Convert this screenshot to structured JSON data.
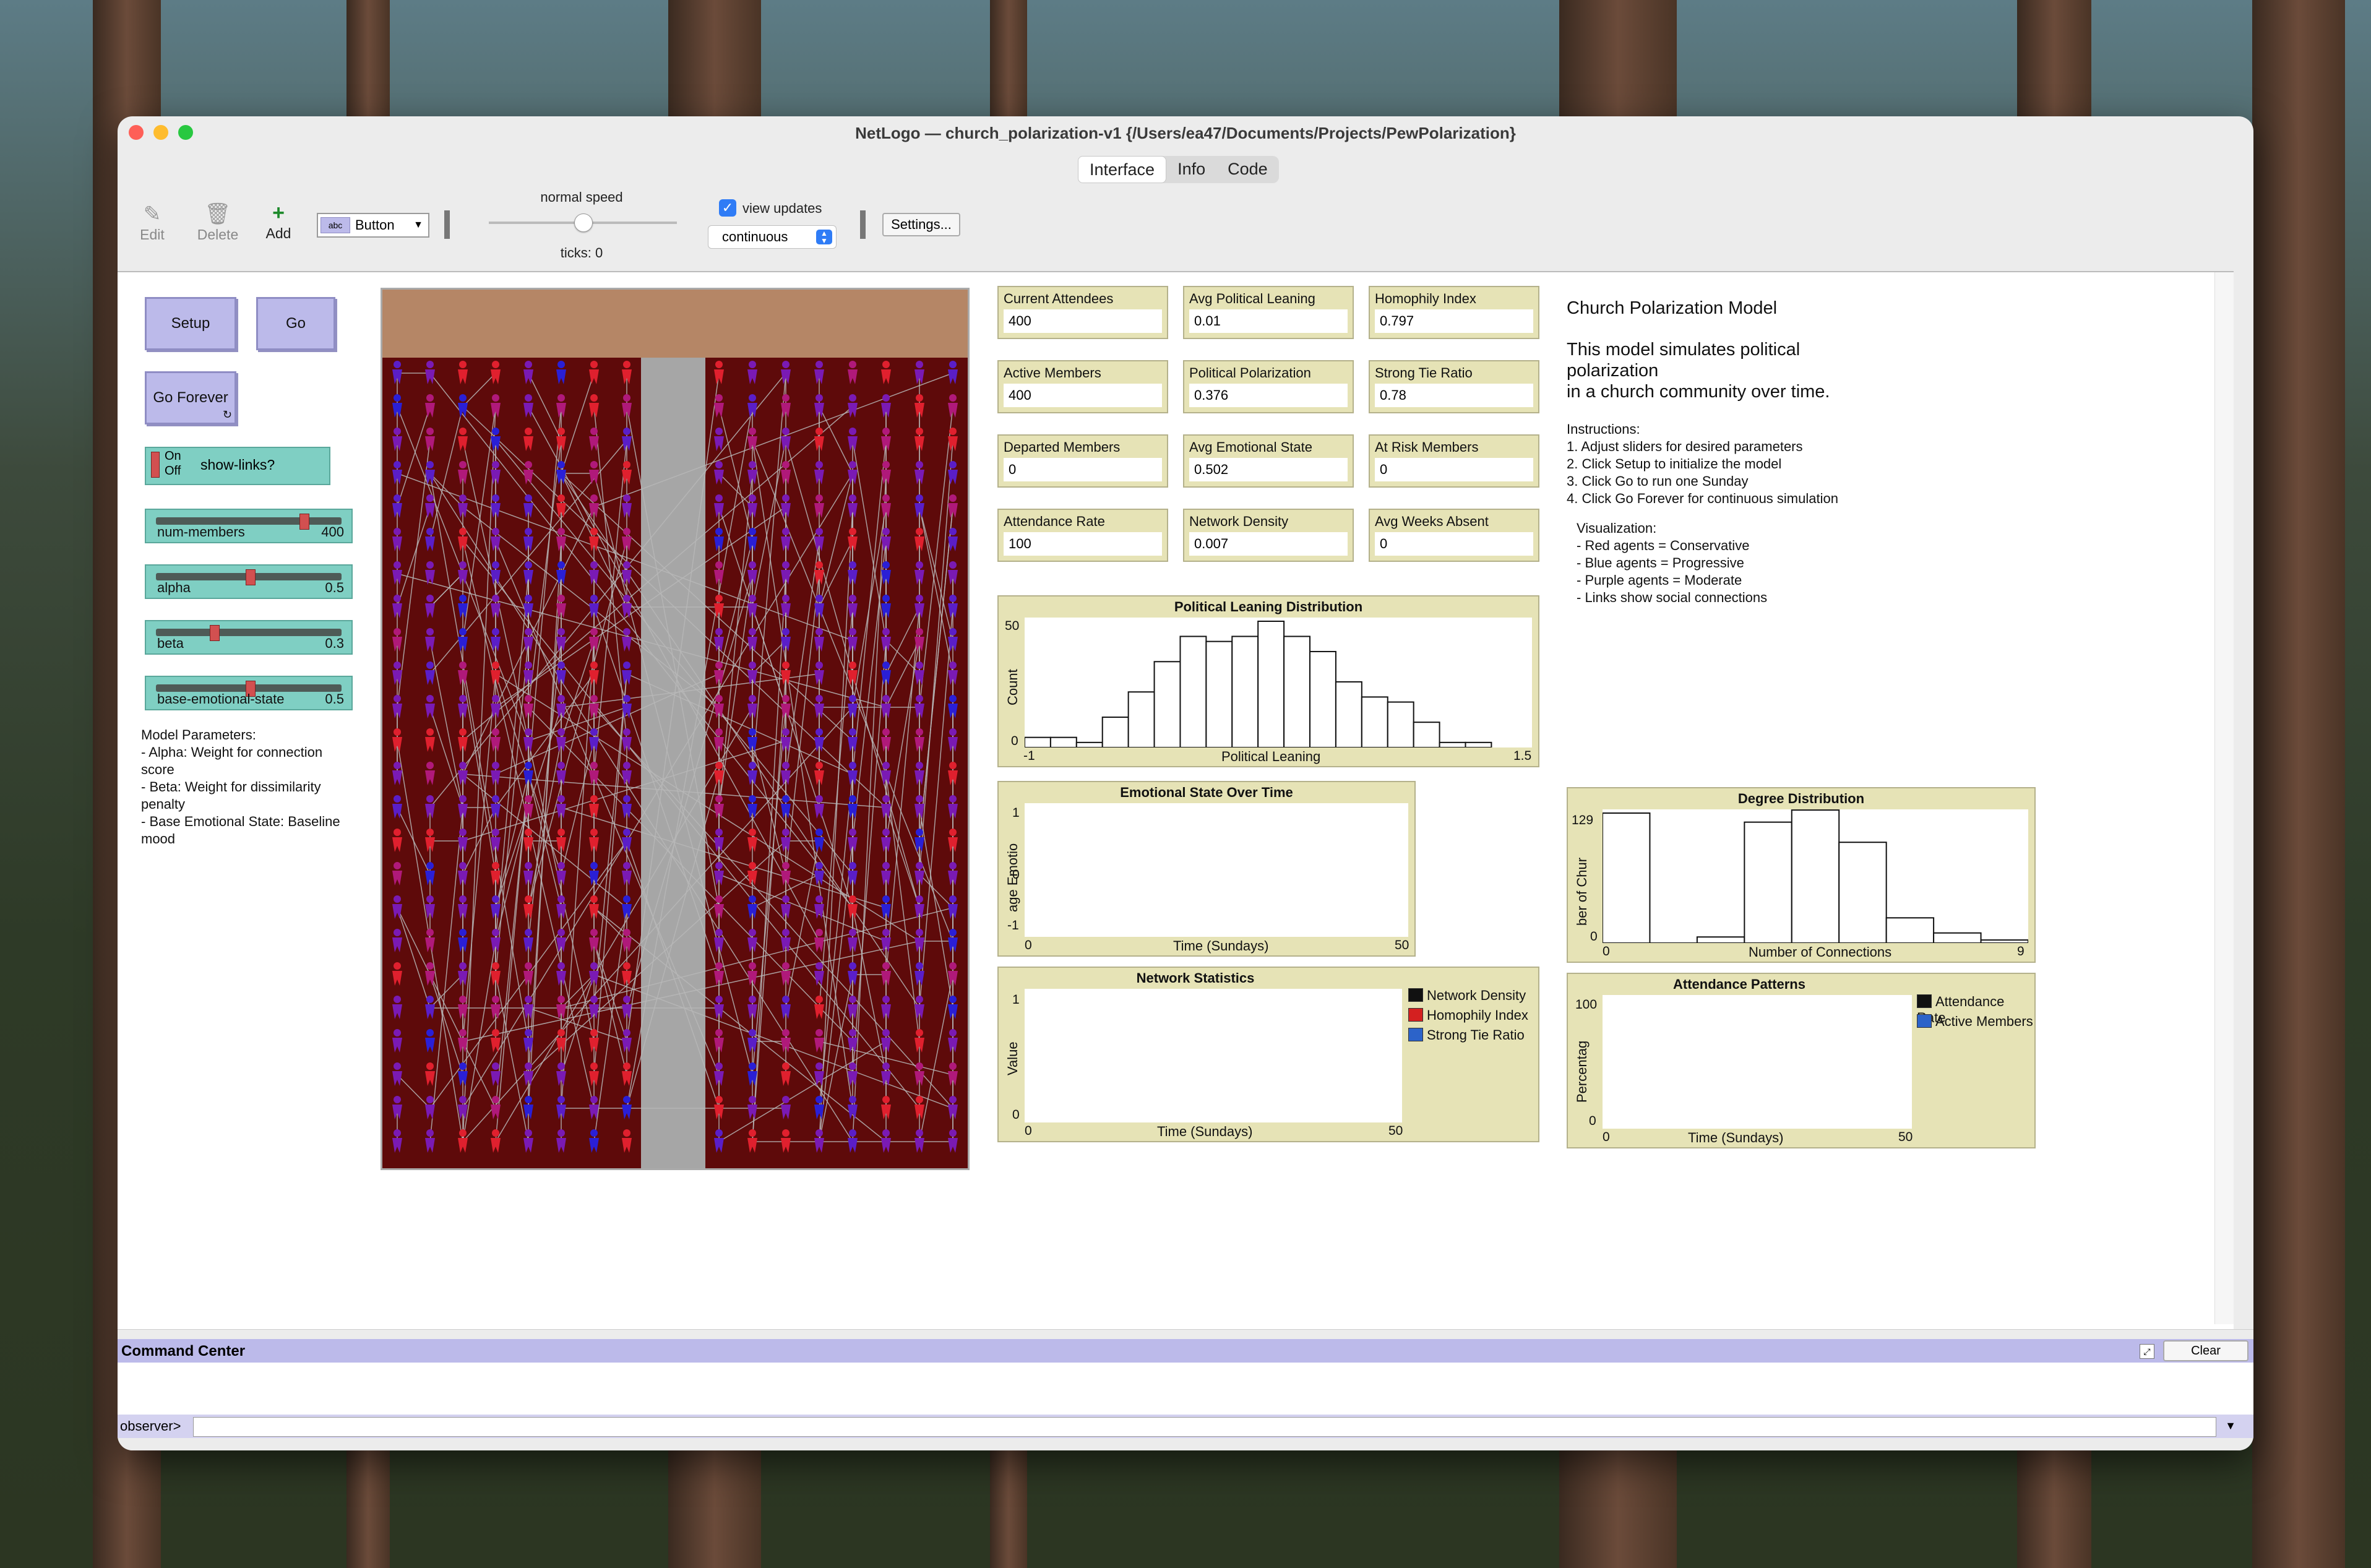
{
  "window": {
    "title": "NetLogo — church_polarization-v1 {/Users/ea47/Documents/Projects/PewPolarization}",
    "tabs": [
      "Interface",
      "Info",
      "Code"
    ],
    "active_tab": "Interface"
  },
  "toolbar": {
    "edit": "Edit",
    "delete": "Delete",
    "add": "Add",
    "widget_type": "Button",
    "speed_label": "normal speed",
    "speed_fraction": 0.5,
    "ticks": "ticks: 0",
    "view_updates": "view updates",
    "view_updates_checked": true,
    "update_mode": "continuous",
    "settings": "Settings..."
  },
  "controls": {
    "setup": "Setup",
    "go": "Go",
    "go_forever": "Go Forever",
    "switch_on": "On",
    "switch_off": "Off",
    "switch_label": "show-links?",
    "sliders": [
      {
        "label": "num-members",
        "value": "400",
        "fraction": 0.8
      },
      {
        "label": "alpha",
        "value": "0.5",
        "fraction": 0.5
      },
      {
        "label": "beta",
        "value": "0.3",
        "fraction": 0.3
      },
      {
        "label": "base-emotional-state",
        "value": "0.5",
        "fraction": 0.5
      }
    ],
    "notes": "Model Parameters:\n- Alpha: Weight for connection score\n- Beta: Weight for dissimilarity penalty\n- Base Emotional State: Baseline mood"
  },
  "monitors": [
    {
      "label": "Current Attendees",
      "value": "400"
    },
    {
      "label": "Avg Political Leaning",
      "value": "0.01"
    },
    {
      "label": "Homophily Index",
      "value": "0.797"
    },
    {
      "label": "Active Members",
      "value": "400"
    },
    {
      "label": "Political Polarization",
      "value": "0.376"
    },
    {
      "label": "Strong Tie Ratio",
      "value": "0.78"
    },
    {
      "label": "Departed Members",
      "value": "0"
    },
    {
      "label": "Avg Emotional State",
      "value": "0.502"
    },
    {
      "label": "At Risk Members",
      "value": "0"
    },
    {
      "label": "Attendance Rate",
      "value": "100"
    },
    {
      "label": "Network Density",
      "value": "0.007"
    },
    {
      "label": "Avg Weeks Absent",
      "value": "0"
    }
  ],
  "plots": {
    "leaning": {
      "title": "Political Leaning Distribution",
      "xlabel": "Political Leaning",
      "ylabel": "Count",
      "xmin": "-1",
      "xmax": "1.5",
      "ymin": "0",
      "ymax": "50"
    },
    "emotion": {
      "title": "Emotional State Over Time",
      "xlabel": "Time (Sundays)",
      "ylabel": "age Emotio",
      "xmin": "0",
      "xmax": "50",
      "ymin": "-1",
      "ymax": "1",
      "ymid": "0"
    },
    "network": {
      "title": "Network Statistics",
      "xlabel": "Time (Sundays)",
      "ylabel": "Value",
      "xmin": "0",
      "xmax": "50",
      "ymin": "0",
      "ymax": "1"
    },
    "degree": {
      "title": "Degree Distribution",
      "xlabel": "Number of Connections",
      "ylabel": "ber of Chur",
      "xmin": "0",
      "xmax": "9",
      "ymin": "0",
      "ymax": "129"
    },
    "attendance": {
      "title": "Attendance Patterns",
      "xlabel": "Time (Sundays)",
      "ylabel": "Percentag",
      "xmin": "0",
      "xmax": "50",
      "ymin": "0",
      "ymax": "100"
    }
  },
  "legends": {
    "network": [
      {
        "name": "Network Density",
        "color": "#111111"
      },
      {
        "name": "Homophily Index",
        "color": "#d42020"
      },
      {
        "name": "Strong Tie Ratio",
        "color": "#2c63c9"
      }
    ],
    "attendance": [
      {
        "name": "Attendance Rate",
        "color": "#111111"
      },
      {
        "name": "Active Members",
        "color": "#2c63c9"
      }
    ]
  },
  "chart_data": [
    {
      "type": "bar",
      "title": "Political Leaning Distribution",
      "xlabel": "Political Leaning",
      "ylabel": "Count",
      "xlim": [
        -1,
        1.5
      ],
      "ylim": [
        0,
        50
      ],
      "values": [
        4,
        4,
        2,
        12,
        22,
        34,
        44,
        42,
        44,
        50,
        44,
        38,
        26,
        20,
        18,
        10,
        2,
        2
      ]
    },
    {
      "type": "line",
      "title": "Emotional State Over Time",
      "xlabel": "Time (Sundays)",
      "xlim": [
        0,
        50
      ],
      "ylim": [
        -1,
        1
      ],
      "series": []
    },
    {
      "type": "line",
      "title": "Network Statistics",
      "xlabel": "Time (Sundays)",
      "ylabel": "Value",
      "xlim": [
        0,
        50
      ],
      "ylim": [
        0,
        1
      ],
      "series": []
    },
    {
      "type": "bar",
      "title": "Degree Distribution",
      "xlabel": "Number of Connections",
      "xlim": [
        0,
        9
      ],
      "ylim": [
        0,
        129
      ],
      "values": [
        129,
        0,
        6,
        120,
        132,
        100,
        25,
        10,
        3
      ]
    },
    {
      "type": "line",
      "title": "Attendance Patterns",
      "xlabel": "Time (Sundays)",
      "xlim": [
        0,
        50
      ],
      "ylim": [
        0,
        100
      ],
      "series": []
    }
  ],
  "info": {
    "heading": "Church Polarization Model",
    "body": "This model simulates political\npolarization\nin a church community over time.",
    "instructions": "Instructions:\n1. Adjust sliders for desired parameters\n2. Click Setup to initialize the model\n3. Click Go to run one Sunday\n4. Click Go Forever for continuous simulation",
    "visualization": "Visualization:\n- Red agents = Conservative\n- Blue agents = Progressive\n- Purple agents = Moderate\n- Links show social connections"
  },
  "command_center": {
    "title": "Command Center",
    "clear": "Clear",
    "prompt": "observer>"
  },
  "colors": {
    "button": "#bcbaea",
    "monitor": "#e6e3b6",
    "slider": "#7fcfc3",
    "pew_area": "#5e0a0a",
    "aisle": "#a6a6a6",
    "altar": "#b58666",
    "conservative": "#e0202e",
    "progressive": "#2a1fd6",
    "moderate": "#7a1ab4"
  }
}
